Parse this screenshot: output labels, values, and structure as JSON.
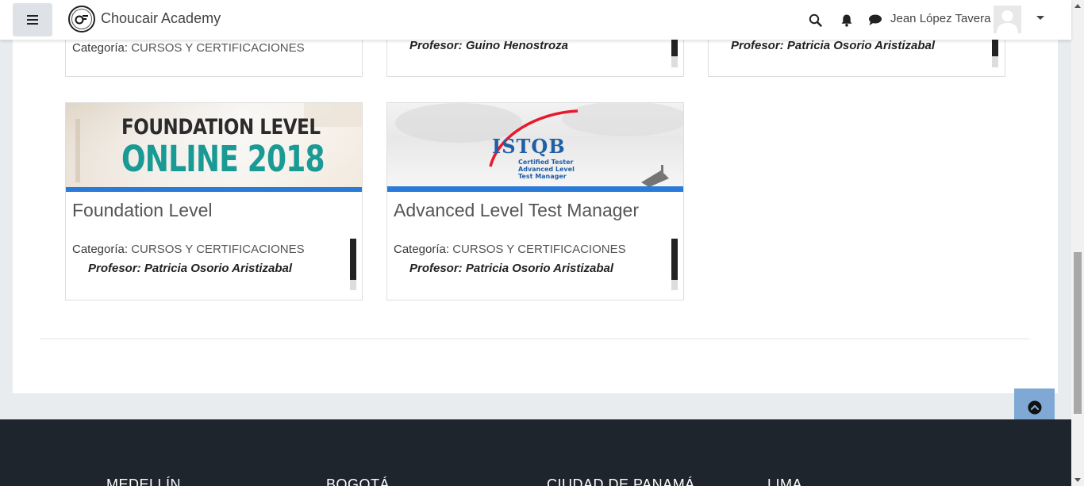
{
  "header": {
    "site_name": "Choucair Academy",
    "user_name": "Jean López Tavera",
    "icons": [
      "menu-icon",
      "search-icon",
      "bell-icon",
      "chat-icon",
      "avatar",
      "caret-down-icon"
    ]
  },
  "courses_top": [
    {
      "category_label": "Categoría:",
      "category": "CURSOS Y CERTIFICACIONES"
    },
    {
      "teacher": "Profesor: Guino Henostroza"
    },
    {
      "teacher": "Profesor: Patricia Osorio Aristizabal"
    }
  ],
  "courses": [
    {
      "image_line1": "FOUNDATION LEVEL",
      "image_line2": "ONLINE 2018",
      "title": "Foundation Level",
      "category_label": "Categoría:",
      "category": "CURSOS Y CERTIFICACIONES",
      "teacher": "Profesor: Patricia Osorio Aristizabal"
    },
    {
      "image_brand": "ISTQB",
      "image_sub1": "Certified Tester",
      "image_sub2": "Advanced Level",
      "image_sub3": "Test Manager",
      "title": "Advanced Level Test Manager",
      "category_label": "Categoría:",
      "category": "CURSOS Y CERTIFICACIONES",
      "teacher": "Profesor: Patricia Osorio Aristizabal"
    }
  ],
  "footer": {
    "cities": [
      "MEDELLÍN",
      "BOGOTÁ",
      "CIUDAD DE PANAMÁ",
      "LIMA"
    ]
  },
  "colors": {
    "accent_bar": "#2a7ad8",
    "footer_bg": "#1f252d",
    "back_to_top": "#7fa9d4",
    "teal": "#1a9a94"
  }
}
